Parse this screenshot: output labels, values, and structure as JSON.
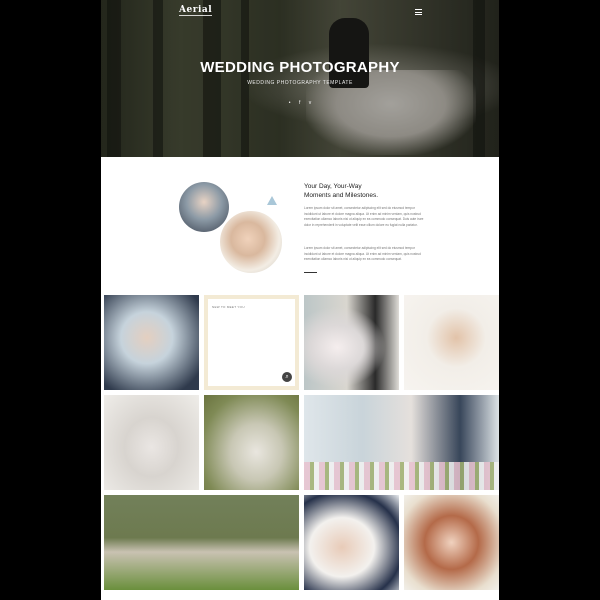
{
  "header": {
    "logo": "Aerial",
    "menu_icon": "hamburger-menu-icon",
    "title": "WEDDING PHOTOGRAPHY",
    "subtitle": "WEDDING PHOTOGRAPHY TEMPLATE",
    "socials": [
      "twitter-icon",
      "facebook-icon",
      "vimeo-icon"
    ],
    "social_glyphs": [
      "•",
      "f",
      "v"
    ]
  },
  "about": {
    "title_line1": "Your Day, Your-Way",
    "title_line2": "Moments and Milestones.",
    "paragraph1": "Lorem ipsum dolor sit amet, consectetur adipiscing elit sed do eiusmod tempor incididunt ut labore et dolore magna aliqua. Ut enim ad minim veniam, quis nostrud exercitation ullamco laboris nisi ut aliquip ex ea commodo consequat. Duis aute irure dolor in reprehenderit in voluptate velit esse cillum dolore eu fugiat nulla pariatur.",
    "paragraph2": "Lorem ipsum dolor sit amet, consectetur adipiscing elit sed do eiusmod tempor incididunt ut labore et dolore magna aliqua. Ut enim ad minim veniam, quis nostrud exercitation ullamco laboris nisi ut aliquip ex ea commodo consequat."
  },
  "gallery": {
    "card_label": "NEW TO MEET YOU",
    "zoom_icon": "magnifier-icon",
    "zoom_glyph": "⌕"
  }
}
